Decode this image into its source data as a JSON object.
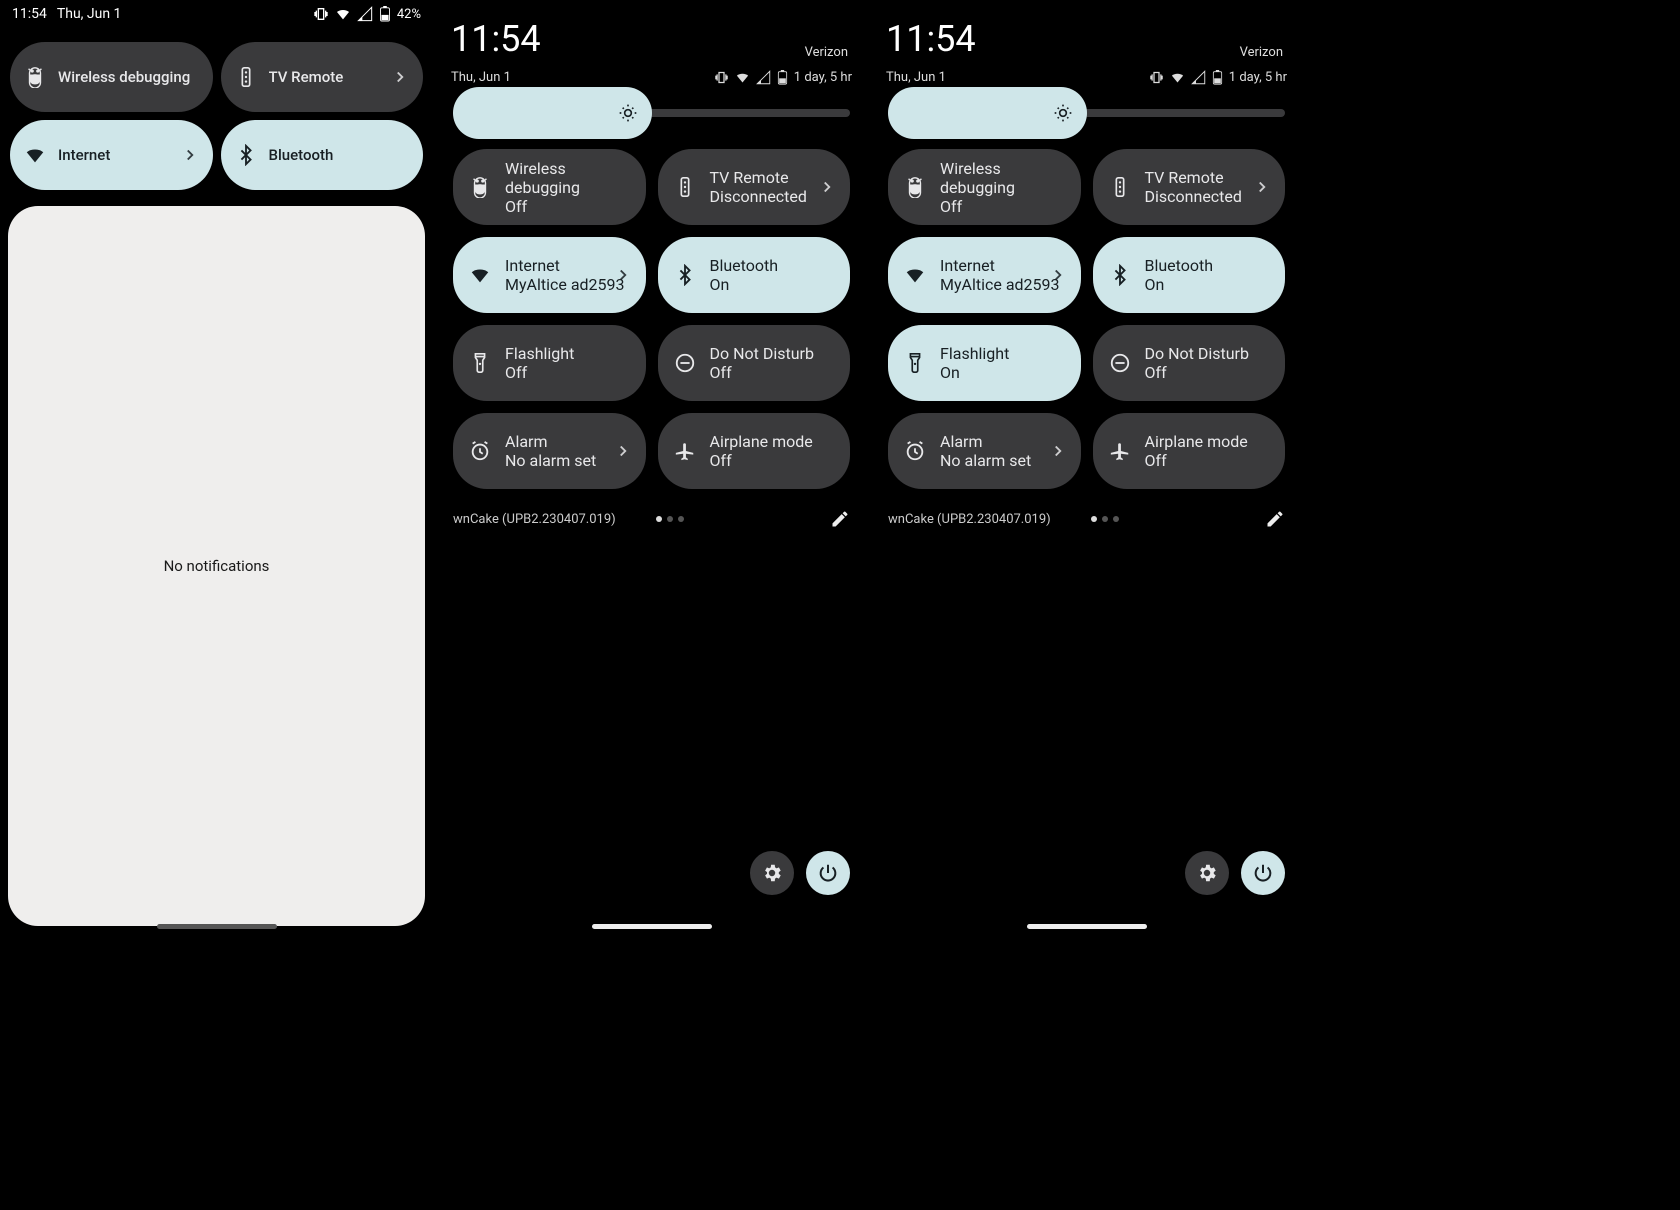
{
  "panel1": {
    "time": "11:54",
    "date": "Thu, Jun 1",
    "battery": "42%",
    "tiles": [
      {
        "label": "Wireless debugging",
        "state": "off",
        "icon": "adb",
        "chevron": false
      },
      {
        "label": "TV Remote",
        "state": "off",
        "icon": "remote",
        "chevron": true
      },
      {
        "label": "Internet",
        "state": "on",
        "icon": "wifi",
        "chevron": true
      },
      {
        "label": "Bluetooth",
        "state": "on",
        "icon": "bluetooth",
        "chevron": false
      }
    ],
    "notif_text": "No notifications"
  },
  "panel2": {
    "time": "11:54",
    "carrier": "Verizon",
    "date": "Thu, Jun 1",
    "battery": "1 day, 5 hr",
    "brightness_pct": 50,
    "tiles": [
      {
        "label": "Wireless debugging",
        "sub": "Off",
        "state": "off",
        "icon": "adb",
        "chevron": false
      },
      {
        "label": "TV Remote",
        "sub": "Disconnected",
        "state": "off",
        "icon": "remote",
        "chevron": true
      },
      {
        "label": "Internet",
        "sub": "MyAltice ad2593",
        "state": "on",
        "icon": "wifi",
        "chevron": true
      },
      {
        "label": "Bluetooth",
        "sub": "On",
        "state": "on",
        "icon": "bluetooth",
        "chevron": false
      },
      {
        "label": "Flashlight",
        "sub": "Off",
        "state": "off",
        "icon": "flashlight",
        "chevron": false
      },
      {
        "label": "Do Not Disturb",
        "sub": "Off",
        "state": "off",
        "icon": "dnd",
        "chevron": false
      },
      {
        "label": "Alarm",
        "sub": "No alarm set",
        "state": "off",
        "icon": "alarm",
        "chevron": true
      },
      {
        "label": "Airplane mode",
        "sub": "Off",
        "state": "off",
        "icon": "airplane",
        "chevron": false
      }
    ],
    "build": "wnCake (UPB2.230407.019)"
  },
  "panel3": {
    "time": "11:54",
    "carrier": "Verizon",
    "date": "Thu, Jun 1",
    "battery": "1 day, 5 hr",
    "brightness_pct": 50,
    "tiles": [
      {
        "label": "Wireless debugging",
        "sub": "Off",
        "state": "off",
        "icon": "adb",
        "chevron": false
      },
      {
        "label": "TV Remote",
        "sub": "Disconnected",
        "state": "off",
        "icon": "remote",
        "chevron": true
      },
      {
        "label": "Internet",
        "sub": "MyAltice ad2593",
        "state": "on",
        "icon": "wifi",
        "chevron": true
      },
      {
        "label": "Bluetooth",
        "sub": "On",
        "state": "on",
        "icon": "bluetooth",
        "chevron": false
      },
      {
        "label": "Flashlight",
        "sub": "On",
        "state": "on",
        "icon": "flashlight",
        "chevron": false
      },
      {
        "label": "Do Not Disturb",
        "sub": "Off",
        "state": "off",
        "icon": "dnd",
        "chevron": false
      },
      {
        "label": "Alarm",
        "sub": "No alarm set",
        "state": "off",
        "icon": "alarm",
        "chevron": true
      },
      {
        "label": "Airplane mode",
        "sub": "Off",
        "state": "off",
        "icon": "airplane",
        "chevron": false
      }
    ],
    "build": "wnCake (UPB2.230407.019)"
  }
}
